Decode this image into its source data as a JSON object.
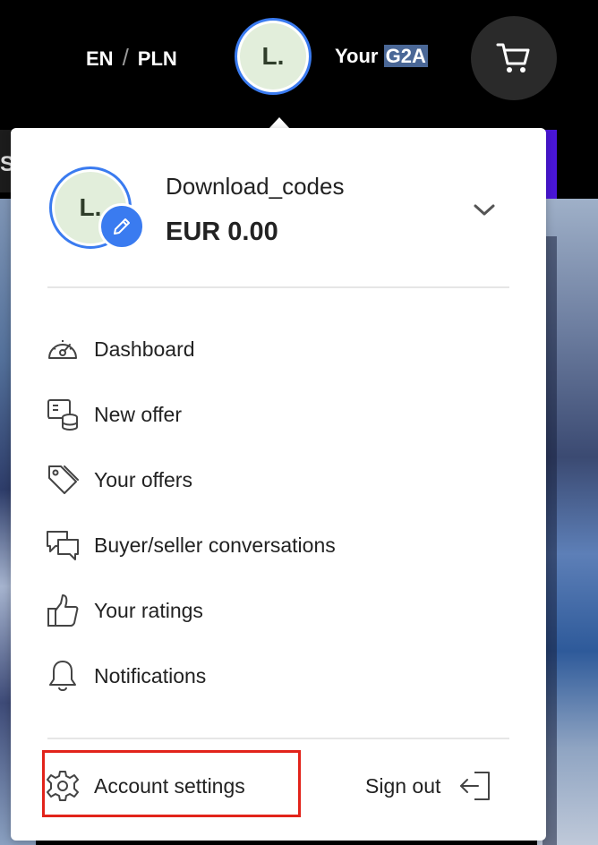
{
  "header": {
    "lang_code": "EN",
    "separator": "/",
    "currency_code": "PLN",
    "avatar_initial": "L.",
    "your_prefix": "Your",
    "your_brand": "G2A",
    "cart_icon": "cart-icon"
  },
  "background": {
    "partial_letter": "S"
  },
  "account": {
    "avatar_initial": "L.",
    "username": "Download_codes",
    "balance": "EUR 0.00",
    "edit_icon": "pencil-icon",
    "expand_icon": "chevron-down-icon"
  },
  "menu": {
    "items": [
      {
        "label": "Dashboard",
        "icon": "dashboard-gauge-icon"
      },
      {
        "label": "New offer",
        "icon": "new-offer-icon"
      },
      {
        "label": "Your offers",
        "icon": "tag-icon"
      },
      {
        "label": "Buyer/seller conversations",
        "icon": "chat-bubbles-icon"
      },
      {
        "label": "Your ratings",
        "icon": "thumbs-up-icon"
      },
      {
        "label": "Notifications",
        "icon": "bell-icon"
      }
    ]
  },
  "footer": {
    "settings_label": "Account settings",
    "settings_icon": "gear-icon",
    "signout_label": "Sign out",
    "signout_icon": "sign-out-icon"
  },
  "colors": {
    "accent": "#3a7bf0",
    "highlight": "#e2231a",
    "avatar_bg": "#e2eedb"
  }
}
